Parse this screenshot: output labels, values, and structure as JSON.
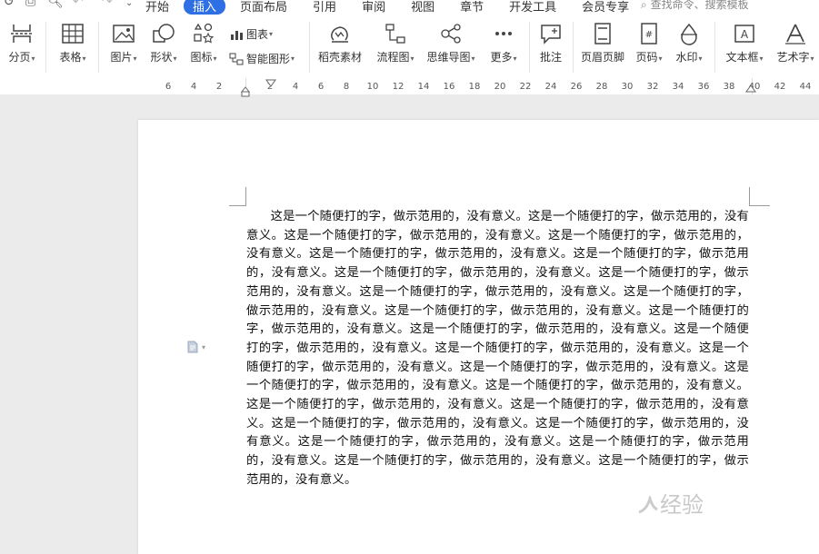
{
  "title_bar": {
    "tabs": [
      "开始",
      "插入",
      "页面布局",
      "引用",
      "审阅",
      "视图",
      "章节",
      "开发工具",
      "会员专享"
    ],
    "active_tab": "插入",
    "search_placeholder": "查找命令、搜索模板"
  },
  "ribbon": {
    "page_break": "分页",
    "table": "表格",
    "picture": "图片",
    "shape": "形状",
    "icon": "图标",
    "chart": "图表",
    "smart_art": "智能图形",
    "material": "稻壳素材",
    "flowchart": "流程图",
    "mindmap": "思维导图",
    "more": "更多",
    "comment": "批注",
    "header_footer": "页眉页脚",
    "page_number": "页码",
    "watermark": "水印",
    "textbox": "文本框",
    "wordart": "艺术字"
  },
  "ruler": {
    "ticks": [
      "6",
      "4",
      "2",
      "2",
      "4",
      "6",
      "8",
      "10",
      "12",
      "14",
      "16",
      "18",
      "20",
      "22",
      "24",
      "26",
      "28",
      "30",
      "32",
      "34",
      "36",
      "38",
      "40",
      "42",
      "44"
    ]
  },
  "document": {
    "paragraph": "这是一个随便打的字，做示范用的，没有意义。这是一个随便打的字，做示范用的，没有意义。这是一个随便打的字，做示范用的，没有意义。这是一个随便打的字，做示范用的，没有意义。这是一个随便打的字，做示范用的，没有意义。这是一个随便打的字，做示范用的，没有意义。这是一个随便打的字，做示范用的，没有意义。这是一个随便打的字，做示范用的，没有意义。这是一个随便打的字，做示范用的，没有意义。这是一个随便打的字，做示范用的，没有意义。这是一个随便打的字，做示范用的，没有意义。这是一个随便打的字，做示范用的，没有意义。这是一个随便打的字，做示范用的，没有意义。这是一个随便打的字，做示范用的，没有意义。这是一个随便打的字，做示范用的，没有意义。这是一个随便打的字，做示范用的，没有意义。这是一个随便打的字，做示范用的，没有意义。这是一个随便打的字，做示范用的，没有意义。这是一个随便打的字，做示范用的，没有意义。这是一个随便打的字，做示范用的，没有意义。这是一个随便打的字，做示范用的，没有意义。这是一个随便打的字，做示范用的，没有意义。这是一个随便打的字，做示范用的，没有意义。这是一个随便打的字，做示范用的，没有意义。这是一个随便打的字，做示范用的，没有意义。这是一个随便打的字，做示范用的，没有意义。这是一个随便打的字，做示范用的，没有意义。"
  },
  "watermark_text": "经验",
  "colors": {
    "accent": "#2f6fe4",
    "workspace": "#ebebeb"
  }
}
